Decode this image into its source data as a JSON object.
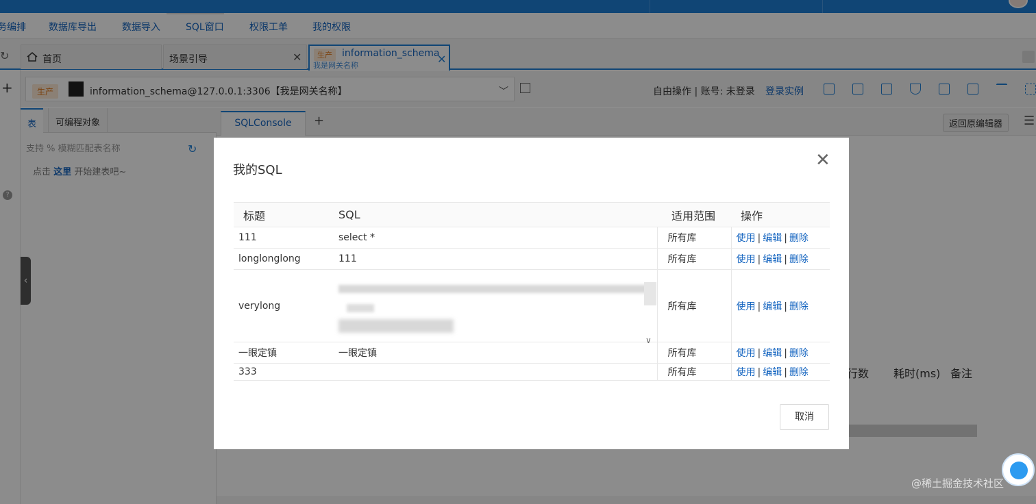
{
  "menu": {
    "items": [
      "务编排",
      "数据库导出",
      "数据导入",
      "SQL窗口",
      "权限工单",
      "我的权限"
    ]
  },
  "tabs": [
    {
      "label": "首页"
    },
    {
      "label": "场景引导"
    },
    {
      "env": "生产",
      "label": "information_schema",
      "sublabel": "我是网关名称"
    }
  ],
  "connection": {
    "env": "生产",
    "text": "information_schema@127.0.0.1:3306【我是网关名称】",
    "status": "自由操作 | 账号: 未登录",
    "login_link": "登录实例"
  },
  "left_panel": {
    "tabs": [
      "表",
      "可编程对象"
    ],
    "search_placeholder": "支持 % 模糊匹配表名称",
    "hint_prefix": "点击",
    "hint_link": "这里",
    "hint_suffix": "开始建表吧~"
  },
  "editor": {
    "tab": "SQLConsole",
    "back_button": "返回原编辑器",
    "result_columns": [
      "行数",
      "耗时(ms)",
      "备注"
    ]
  },
  "modal": {
    "title": "我的SQL",
    "columns": [
      "标题",
      "SQL",
      "适用范围",
      "操作"
    ],
    "rows": [
      {
        "title": "111",
        "sql": "select *",
        "scope": "所有库"
      },
      {
        "title": "longlonglong",
        "sql": "111",
        "scope": "所有库"
      },
      {
        "title": "verylong",
        "sql": "",
        "scope": "所有库"
      },
      {
        "title": "一眼定镇",
        "sql": "一眼定镇",
        "scope": "所有库"
      },
      {
        "title": "333",
        "sql": "",
        "scope": "所有库"
      }
    ],
    "actions": {
      "use": "使用",
      "edit": "编辑",
      "delete": "删除",
      "sep": "|"
    },
    "cancel": "取消"
  },
  "watermark": "@稀土掘金技术社区",
  "colors": {
    "primary": "#1e7fd6",
    "link": "#1565c0",
    "env_tag": "#e07b20"
  }
}
